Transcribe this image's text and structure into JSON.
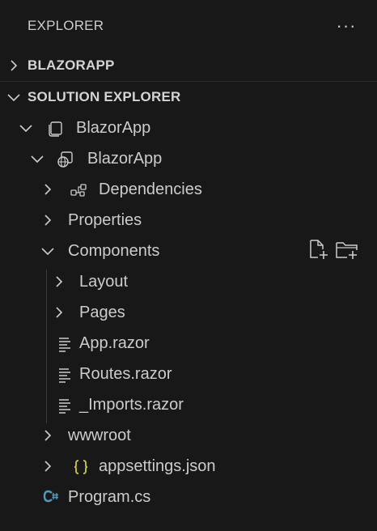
{
  "header": {
    "title": "EXPLORER",
    "more_label": "···"
  },
  "sections": {
    "blazorapp": {
      "label": "BLAZORAPP",
      "expanded": false
    },
    "solution_explorer": {
      "label": "SOLUTION EXPLORER",
      "expanded": true
    }
  },
  "tree": {
    "solution": {
      "label": "BlazorApp",
      "icon": "solution-icon"
    },
    "project": {
      "label": "BlazorApp",
      "icon": "web-project-icon"
    },
    "dependencies": {
      "label": "Dependencies",
      "icon": "dependencies-icon"
    },
    "properties": {
      "label": "Properties"
    },
    "components": {
      "label": "Components",
      "actions": [
        "new-file-icon",
        "new-folder-icon"
      ]
    },
    "layout": {
      "label": "Layout"
    },
    "pages": {
      "label": "Pages"
    },
    "app_razor": {
      "label": "App.razor",
      "icon": "razor-file-icon"
    },
    "routes_razor": {
      "label": "Routes.razor",
      "icon": "razor-file-icon"
    },
    "imports_razor": {
      "label": "_Imports.razor",
      "icon": "razor-file-icon"
    },
    "wwwroot": {
      "label": "wwwroot"
    },
    "appsettings": {
      "label": "appsettings.json",
      "icon": "json-icon"
    },
    "program": {
      "label": "Program.cs",
      "icon": "csharp-icon"
    }
  },
  "colors": {
    "background": "#181818",
    "text": "#cccccc",
    "json_icon": "#cbcb41",
    "csharp_icon": "#519aba"
  }
}
